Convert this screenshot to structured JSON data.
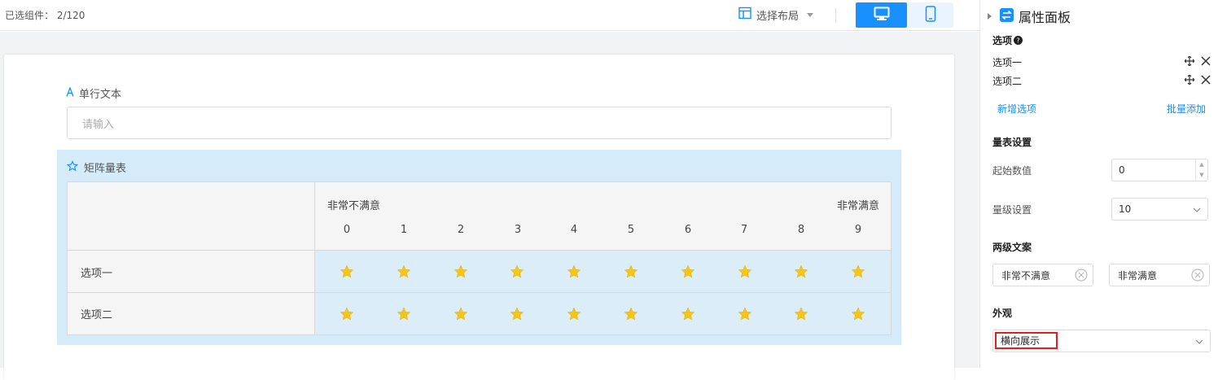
{
  "topbar": {
    "selected_count": "已选组件： 2/120",
    "layout_label": "选择布局"
  },
  "form": {
    "text_field": {
      "label": "单行文本",
      "placeholder": "请输入"
    },
    "matrix": {
      "title": "矩阵量表",
      "low_label": "非常不满意",
      "high_label": "非常满意",
      "scale": [
        "0",
        "1",
        "2",
        "3",
        "4",
        "5",
        "6",
        "7",
        "8",
        "9"
      ],
      "rows": [
        "选项一",
        "选项二"
      ],
      "star_color": "#f5c518"
    }
  },
  "panel": {
    "title": "属性面板",
    "options_title": "选项",
    "options": [
      "选项一",
      "选项二"
    ],
    "add_option": "新增选项",
    "batch_add": "批量添加",
    "scale_settings_title": "量表设置",
    "start_value_label": "起始数值",
    "start_value": "0",
    "levels_label": "量级设置",
    "levels_value": "10",
    "two_level_title": "两级文案",
    "low_text": "非常不满意",
    "high_text": "非常满意",
    "appearance_title": "外观",
    "appearance_value": "横向展示"
  },
  "colors": {
    "accent": "#1890ff",
    "highlight_box": "#e02020",
    "matrix_bg": "#d6ebfa"
  }
}
